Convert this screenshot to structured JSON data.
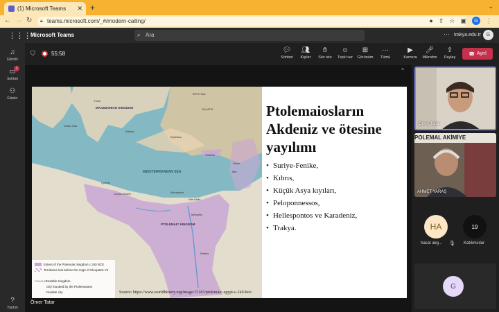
{
  "browser": {
    "tab_title": "(1) Microsoft Teams",
    "tab_close": "✕",
    "new_tab": "+",
    "tab_chevron": "⌄",
    "back": "←",
    "forward": "→",
    "reload": "↻",
    "url": "teams.microsoft.com/_#/modern-calling/",
    "profile_initial": "G"
  },
  "teams_header": {
    "app_name": "Microsoft Teams",
    "search_placeholder": "Ara",
    "more": "···",
    "tenant": "trakya.edu.tr",
    "avatar_initial": "G"
  },
  "rail": {
    "items": [
      {
        "label": "Etkinlik",
        "icon": "bell-icon"
      },
      {
        "label": "Sohbet",
        "icon": "chat-icon",
        "badge": "1"
      },
      {
        "label": "Ekipler",
        "icon": "teams-icon"
      }
    ],
    "help": "Yardım"
  },
  "meeting": {
    "timer": "55:58",
    "controls": [
      {
        "label": "Sohbet",
        "icon": "chat-icon"
      },
      {
        "label": "Kişiler",
        "icon": "people-icon"
      },
      {
        "label": "Söz iste",
        "icon": "raise-hand-icon"
      },
      {
        "label": "Tepki ver",
        "icon": "smiley-icon"
      },
      {
        "label": "Görünüm",
        "icon": "grid-icon"
      },
      {
        "label": "Tümü",
        "icon": "more-icon"
      },
      {
        "label": "Kamera",
        "icon": "camera-off-icon"
      },
      {
        "label": "Mikrofon",
        "icon": "mic-off-icon"
      },
      {
        "label": "Paylaş",
        "icon": "share-icon"
      }
    ],
    "leave_label": "Ayrıl",
    "presenter_name": "Ömer Tatar",
    "share_close": "×"
  },
  "slide": {
    "title": "Ptolemaiosların Akdeniz ve ötesine yayılımı",
    "bullets": [
      "Suriye-Fenike,",
      "Kıbrıs,",
      "Küçük Asya kıyıları,",
      "Peloponnessos,",
      "Hellespontos ve Karadeniz,",
      "Trakya."
    ],
    "source": "Source: https://www.worldhistory.org/image/15183/ptolemaic-egypt-c-240-bce/",
    "map": {
      "labels": {
        "macedonian": "MACEDONIAN KINGDOM",
        "mediterranean": "MEDITERRANEAN SEA",
        "ptolemaic": "PTOLEMAIC KINGDOM",
        "libyan": "Libyan Desert",
        "ionian": "Ionian Sea",
        "cyrene": "Cyrene",
        "alexandria": "Alexandria",
        "memphis": "Memphis",
        "thebes": "Thebes",
        "pella": "Pella",
        "athens": "Athens",
        "ephesus": "Ephesus",
        "salamis": "Salamis",
        "sidon": "Sidon",
        "tyre": "Tyre",
        "nile": "Nile Delta",
        "bithynia": "BITHYNIA",
        "galatia": "GALATIA"
      },
      "legend": [
        "Extent of the Ptolemaic kingdom c.240 BCE",
        "Territories lost before the reign of Cleopatra VII",
        "Notable Kingdom",
        "City founded by the Ptolemaeans",
        "Notable city"
      ],
      "legend_codes": [
        "COLCHIS"
      ]
    }
  },
  "participants": [
    {
      "name": "Ömer Tatar",
      "active": true
    },
    {
      "name": "AHMET YARAŞ"
    }
  ],
  "poster_text": "POLEMAL AKİMİYE",
  "guest": {
    "initials": "HA",
    "name": "hasat akg..."
  },
  "count": {
    "value": "19",
    "label": "Katılımcılar"
  },
  "self": {
    "initial": "G"
  },
  "colors": {
    "leave": "#c4314b",
    "accent": "#7f85f5",
    "tab": "#f7b22f"
  }
}
